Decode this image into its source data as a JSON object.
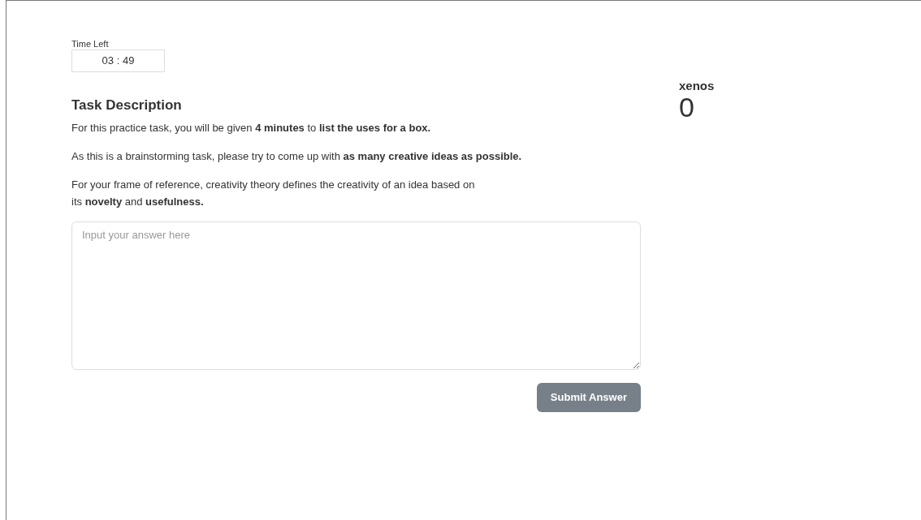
{
  "timer": {
    "label": "Time Left",
    "value": "03 : 49"
  },
  "task": {
    "heading": "Task Description",
    "paragraphs": [
      "For this practice task, you will be given **4 minutes** to **list the uses for a box.**",
      "As this is a brainstorming task, please try to come up with **as many creative ideas as possible.**",
      "For your frame of reference, creativity theory defines the creativity of an idea based on\nits **novelty** and **usefulness.**"
    ]
  },
  "answer": {
    "placeholder": "Input your answer here"
  },
  "submit_button": {
    "label": "Submit Answer"
  },
  "score": {
    "name": "xenos",
    "value": "0"
  }
}
